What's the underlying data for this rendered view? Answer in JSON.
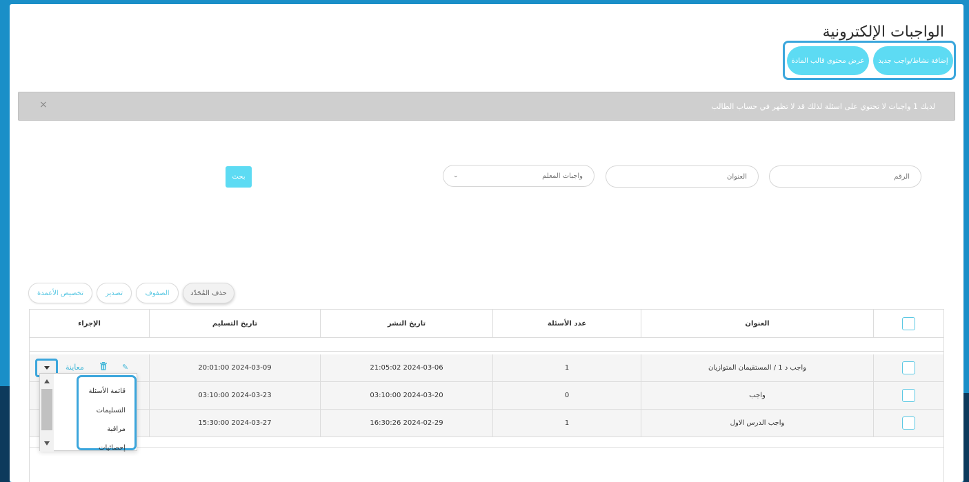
{
  "header": {
    "title": "الواجبات الإلكترونية",
    "add_button": "إضافة نشاط/واجب جديد",
    "view_button": "عرض محتوى قالب المادة"
  },
  "alert": {
    "text": "لديك 1 واجبات لا تحتوي على اسئلة لذلك قد لا تظهر في حساب الطالب",
    "close": "×"
  },
  "filters": {
    "number_placeholder": "الرقم",
    "title_placeholder": "العنوان",
    "select_value": "واجبات المعلم",
    "search_button": "بحث"
  },
  "toolbar": {
    "delete_selected": "حذف المُحَدّد",
    "rows": "الصفوف",
    "export": "تصدير",
    "customize_columns": "تخصيص الأعمدة"
  },
  "table": {
    "columns": {
      "title": "العنوان",
      "questions": "عدد الأسئلة",
      "published": "تاريخ النشر",
      "due": "تاريخ التسليم",
      "action": "الإجراء"
    },
    "rows": [
      {
        "title": "واجب د 1 / المستقيمان المتوازيان",
        "questions": "1",
        "published": "2024-03-06 21:05:02",
        "due": "2024-03-09 20:01:00"
      },
      {
        "title": "واجب",
        "questions": "0",
        "published": "2024-03-20 03:10:00",
        "due": "2024-03-23 03:10:00"
      },
      {
        "title": "واجب الدرس الاول",
        "questions": "1",
        "published": "2024-02-29 16:30:26",
        "due": "2024-03-27 15:30:00"
      }
    ],
    "action_view": "معاينة"
  },
  "dropdown": {
    "items": [
      "قائمة الأسئلة",
      "التسليمات",
      "مراقبة",
      "إحصائيات"
    ]
  },
  "colors": {
    "accent": "#5ddbf3",
    "outline": "#3ba6dc",
    "alert_bg": "#cfcfcf"
  }
}
